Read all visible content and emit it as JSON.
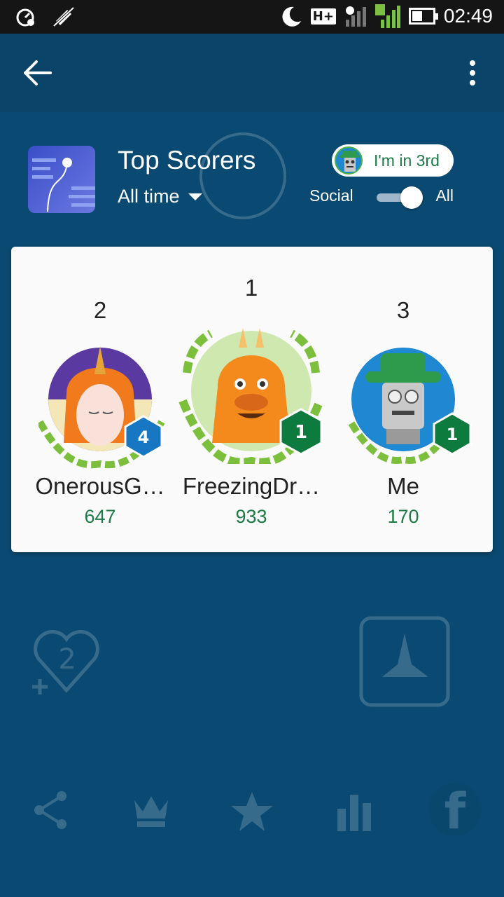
{
  "status_bar": {
    "time": "02:49",
    "network": "H+",
    "sim": "2",
    "battery_level": 0.45
  },
  "app_bar": {
    "back_icon": "arrow-left-icon",
    "menu_icon": "more-vert-icon"
  },
  "leaderboard": {
    "title": "Top Scorers",
    "time_filter": "All time",
    "my_rank_label": "I'm in 3rd",
    "toggle_left_label": "Social",
    "toggle_right_label": "All",
    "toggle_selected": "All"
  },
  "podium": [
    {
      "place": "2",
      "name": "OnerousG…",
      "score": "647",
      "level": "4",
      "badge_color": "#1877c2",
      "avatar": "unicorn-avatar"
    },
    {
      "place": "1",
      "name": "FreezingDr…",
      "score": "933",
      "level": "1",
      "badge_color": "#0d7a3e",
      "avatar": "dragon-avatar"
    },
    {
      "place": "3",
      "name": "Me",
      "score": "170",
      "level": "1",
      "badge_color": "#0d7a3e",
      "avatar": "robot-avatar"
    }
  ],
  "background_hint": {
    "lives_count": "2"
  },
  "colors": {
    "background": "#0a4a72",
    "app_bar": "#0a4468",
    "score_green": "#1b7a45"
  }
}
